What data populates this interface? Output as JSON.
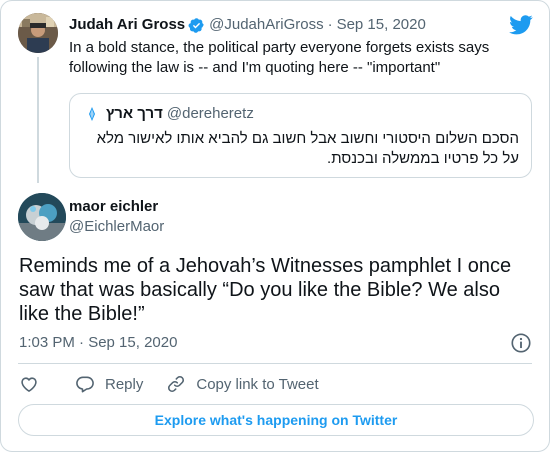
{
  "parent_tweet": {
    "author_name": "Judah Ari Gross",
    "author_handle": "@JudahAriGross",
    "separator": "·",
    "date": "Sep 15, 2020",
    "text": "In a bold stance, the political party everyone forgets exists says following the law is -- and I'm quoting here -- \"important\""
  },
  "quoted_tweet": {
    "author_name": "דרך ארץ",
    "author_handle": "@dereheretz",
    "text": "הסכם השלום היסטורי וחשוב אבל חשוב גם להביא אותו לאישור מלא על כל פרטיו בממשלה ובכנסת."
  },
  "main_tweet": {
    "author_name": "maor eichler",
    "author_handle": "@EichlerMaor",
    "text": "Reminds me of a Jehovah’s Witnesses pamphlet I once saw that was basically “Do you like the Bible? We also like the Bible!”",
    "timestamp": "1:03 PM · Sep 15, 2020"
  },
  "actions": {
    "reply_label": "Reply",
    "copy_link_label": "Copy link to Tweet"
  },
  "explore_label": "Explore what's happening on Twitter",
  "colors": {
    "brand_blue": "#1d9bf0",
    "text": "#0f1419",
    "muted": "#536471",
    "border": "#cfd9de"
  },
  "icons": [
    "twitter-bird-icon",
    "verified-badge-icon",
    "info-icon",
    "heart-icon",
    "reply-bubble-icon",
    "link-icon"
  ]
}
